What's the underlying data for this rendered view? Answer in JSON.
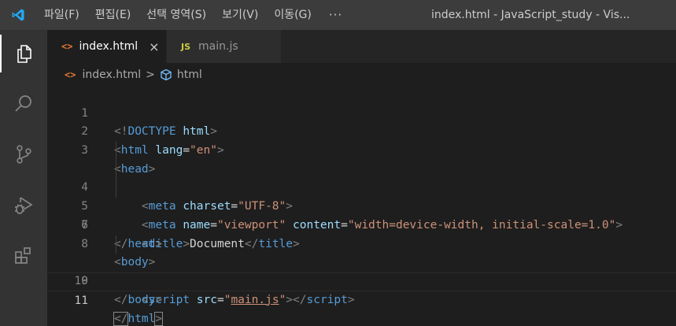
{
  "titlebar": {
    "menu": [
      "파일(F)",
      "편집(E)",
      "선택 영역(S)",
      "보기(V)",
      "이동(G)"
    ],
    "more": "···",
    "window_title": "index.html - JavaScript_study - Vis..."
  },
  "activitybar": {
    "items": [
      "explorer-icon",
      "search-icon",
      "source-control-icon",
      "run-debug-icon",
      "extensions-icon"
    ],
    "accent": "#ffffff"
  },
  "tabs": [
    {
      "icon": "<>",
      "label": "index.html",
      "close": "×",
      "active": true
    },
    {
      "icon": "JS",
      "label": "main.js",
      "active": false
    }
  ],
  "breadcrumb": {
    "file_icon": "<>",
    "file": "index.html",
    "separator": ">",
    "symbol": "html"
  },
  "code": {
    "line_numbers": [
      "1",
      "2",
      "3",
      "4",
      "5",
      "6",
      "7",
      "8",
      "9",
      "10",
      "11"
    ],
    "lines": [
      [
        "<!",
        "DOCTYPE",
        " ",
        "html",
        ">"
      ],
      [
        "<",
        "html",
        " ",
        "lang",
        "=",
        "\"en\"",
        ">"
      ],
      [
        "<",
        "head",
        ">"
      ],
      [
        "    ",
        "<",
        "meta",
        " ",
        "charset",
        "=",
        "\"UTF-8\"",
        ">"
      ],
      [
        "    ",
        "<",
        "meta",
        " ",
        "name",
        "=",
        "\"viewport\"",
        " ",
        "content",
        "=",
        "\"width=device-width, initial-scale=1.0\"",
        ">"
      ],
      [
        "    ",
        "<",
        "title",
        ">",
        "Document",
        "</",
        "title",
        ">"
      ],
      [
        "</",
        "head",
        ">"
      ],
      [
        "<",
        "body",
        ">"
      ],
      [
        "    ",
        "<",
        "script",
        " ",
        "src",
        "=",
        "\"",
        "main.js",
        "\"",
        "></",
        "script",
        ">"
      ],
      [
        "</",
        "body",
        ">"
      ],
      [
        "</",
        "html",
        ">"
      ]
    ]
  },
  "colors": {
    "editor_bg": "#1e1e1e",
    "titlebar_bg": "#3c3c3c",
    "activitybar_bg": "#333333",
    "tag": "#569cd6",
    "attribute": "#9cdcfe",
    "string": "#ce9178",
    "punctuation": "#808080",
    "html_icon": "#e37933",
    "js_icon": "#cbcb41",
    "vscode_blue": "#23a9f2"
  }
}
